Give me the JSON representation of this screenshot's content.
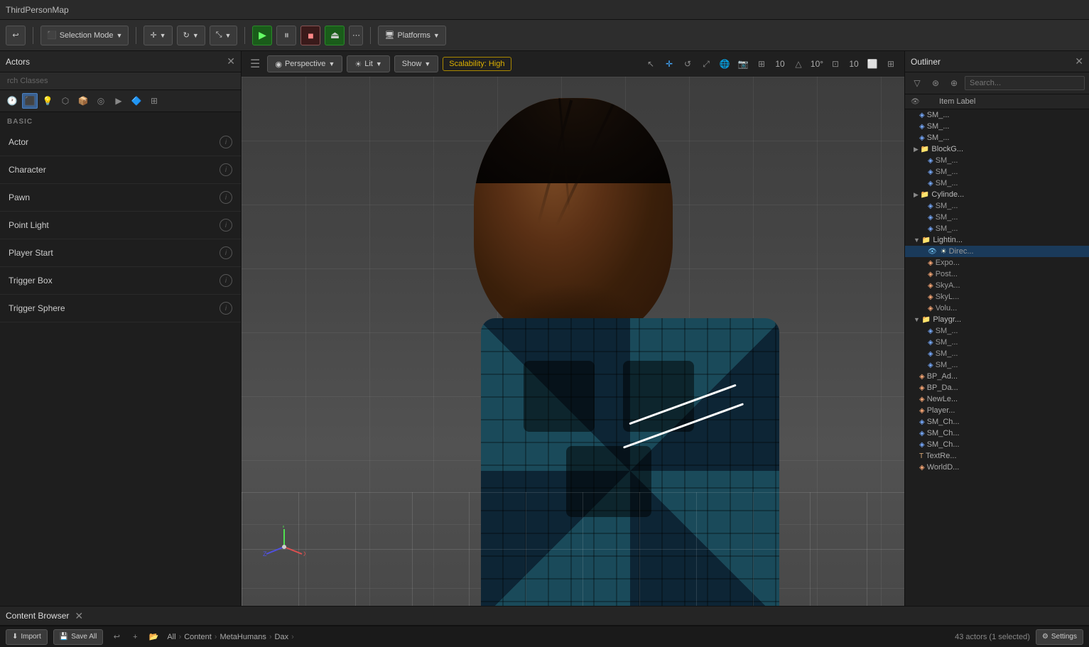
{
  "titleBar": {
    "title": "ThirdPersonMap"
  },
  "toolbar": {
    "selectionMode": "Selection Mode",
    "platforms": "Platforms",
    "playBtn": "▶",
    "pauseBtn": "⏸",
    "stopBtn": "⏹",
    "ejectBtn": "⏏"
  },
  "actorsPanel": {
    "title": "Actors",
    "searchPlaceholder": "rch Classes",
    "sectionLabel": "BASIC",
    "items": [
      {
        "label": "Actor",
        "id": "actor"
      },
      {
        "label": "Character",
        "id": "character"
      },
      {
        "label": "Pawn",
        "id": "pawn"
      },
      {
        "label": "Point Light",
        "id": "point-light"
      },
      {
        "label": "Player Start",
        "id": "player-start"
      },
      {
        "label": "Trigger Box",
        "id": "trigger-box"
      },
      {
        "label": "Trigger Sphere",
        "id": "trigger-sphere"
      }
    ]
  },
  "viewport": {
    "hamburgerIcon": "☰",
    "perspectiveLabel": "Perspective",
    "litLabel": "Lit",
    "showLabel": "Show",
    "scalabilityLabel": "Scalability: High"
  },
  "outliner": {
    "title": "Outliner",
    "searchPlaceholder": "Search...",
    "itemLabelHeader": "Item Label",
    "items": [
      {
        "label": "SM_...",
        "type": "mesh",
        "indent": 2,
        "id": "sm1"
      },
      {
        "label": "SM_...",
        "type": "mesh",
        "indent": 2,
        "id": "sm2"
      },
      {
        "label": "SM_...",
        "type": "mesh",
        "indent": 2,
        "id": "sm3"
      },
      {
        "label": "BlockG...",
        "type": "folder",
        "indent": 1,
        "id": "blockg"
      },
      {
        "label": "SM_...",
        "type": "mesh",
        "indent": 2,
        "id": "sm4"
      },
      {
        "label": "SM_...",
        "type": "mesh",
        "indent": 2,
        "id": "sm5"
      },
      {
        "label": "SM_...",
        "type": "mesh",
        "indent": 2,
        "id": "sm6"
      },
      {
        "label": "Cylinde...",
        "type": "folder",
        "indent": 1,
        "id": "cylinde"
      },
      {
        "label": "SM_...",
        "type": "mesh",
        "indent": 2,
        "id": "sm7"
      },
      {
        "label": "SM_...",
        "type": "mesh",
        "indent": 2,
        "id": "sm8"
      },
      {
        "label": "SM_...",
        "type": "mesh",
        "indent": 2,
        "id": "sm9"
      },
      {
        "label": "Lightin...",
        "type": "folder",
        "indent": 1,
        "id": "lightin"
      },
      {
        "label": "Direc...",
        "type": "light",
        "indent": 2,
        "id": "direc",
        "selected": true,
        "visible": true
      },
      {
        "label": "Expo...",
        "type": "actor",
        "indent": 2,
        "id": "expo"
      },
      {
        "label": "Post...",
        "type": "actor",
        "indent": 2,
        "id": "post"
      },
      {
        "label": "SkyA...",
        "type": "actor",
        "indent": 2,
        "id": "skya"
      },
      {
        "label": "SkyL...",
        "type": "actor",
        "indent": 2,
        "id": "skyl"
      },
      {
        "label": "Volu...",
        "type": "actor",
        "indent": 2,
        "id": "volu"
      },
      {
        "label": "Playgr...",
        "type": "folder",
        "indent": 1,
        "id": "playgr"
      },
      {
        "label": "SM_...",
        "type": "mesh",
        "indent": 2,
        "id": "sm10"
      },
      {
        "label": "SM_...",
        "type": "mesh",
        "indent": 2,
        "id": "sm11"
      },
      {
        "label": "SM_...",
        "type": "mesh",
        "indent": 2,
        "id": "sm12"
      },
      {
        "label": "SM_...",
        "type": "mesh",
        "indent": 2,
        "id": "sm13"
      },
      {
        "label": "BP_Ad...",
        "type": "actor",
        "indent": 1,
        "id": "bpad"
      },
      {
        "label": "BP_Da...",
        "type": "actor",
        "indent": 1,
        "id": "bpda"
      },
      {
        "label": "NewLe...",
        "type": "actor",
        "indent": 1,
        "id": "newle"
      },
      {
        "label": "Player...",
        "type": "actor",
        "indent": 1,
        "id": "player"
      },
      {
        "label": "SM_Ch...",
        "type": "mesh",
        "indent": 1,
        "id": "smch"
      },
      {
        "label": "SM_Ch...",
        "type": "mesh",
        "indent": 1,
        "id": "smch2"
      },
      {
        "label": "SM_Ch...",
        "type": "mesh",
        "indent": 1,
        "id": "smch3"
      },
      {
        "label": "TextRe...",
        "type": "actor",
        "indent": 1,
        "id": "textre"
      },
      {
        "label": "WorldD...",
        "type": "actor",
        "indent": 1,
        "id": "worldd"
      }
    ]
  },
  "statusBar": {
    "importLabel": "Import",
    "saveAllLabel": "Save All",
    "allLabel": "All",
    "contentLabel": "Content",
    "metaHumansLabel": "MetaHumans",
    "daxLabel": "Dax",
    "settingsLabel": "Settings",
    "actorCount": "43 actors (1 selected)",
    "contentBrowserTitle": "Content Browser"
  },
  "colors": {
    "accent": "#4a90d9",
    "selected": "#1a3a5a",
    "scalabilityHigh": "#ddb000",
    "playGreen": "#6fda6f",
    "folderColor": "#cc9944",
    "meshColor": "#7ab4f5",
    "lightColor": "#ffd080"
  }
}
